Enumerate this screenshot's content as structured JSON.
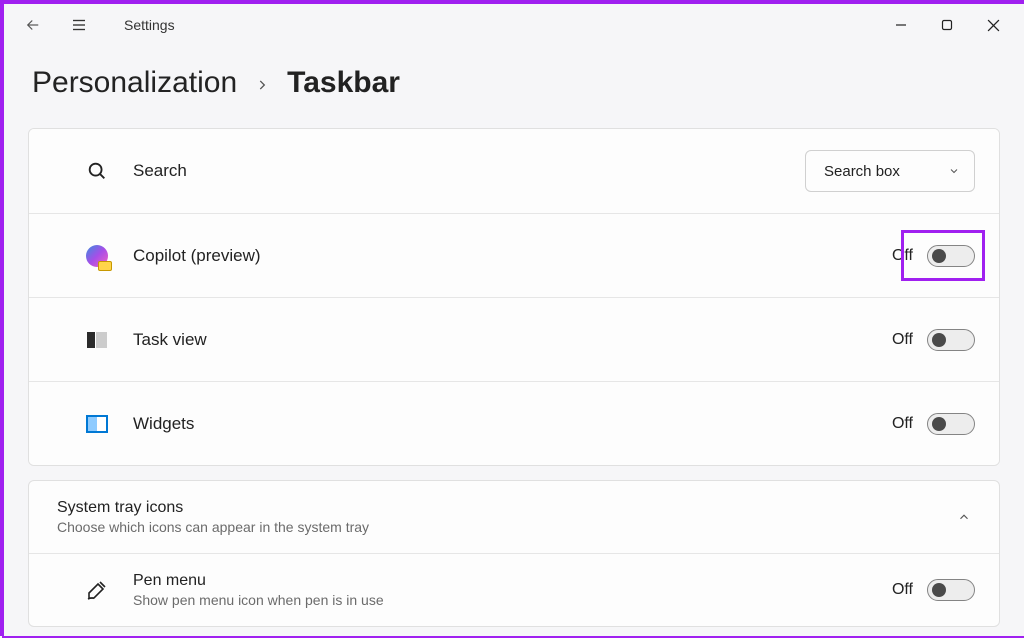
{
  "app": {
    "title": "Settings"
  },
  "breadcrumb": {
    "parent": "Personalization",
    "current": "Taskbar"
  },
  "rows": {
    "search": {
      "label": "Search",
      "dropdown": "Search box"
    },
    "copilot": {
      "label": "Copilot (preview)",
      "state": "Off"
    },
    "taskview": {
      "label": "Task view",
      "state": "Off"
    },
    "widgets": {
      "label": "Widgets",
      "state": "Off"
    }
  },
  "section": {
    "title": "System tray icons",
    "subtitle": "Choose which icons can appear in the system tray"
  },
  "pen": {
    "label": "Pen menu",
    "subtitle": "Show pen menu icon when pen is in use",
    "state": "Off"
  }
}
